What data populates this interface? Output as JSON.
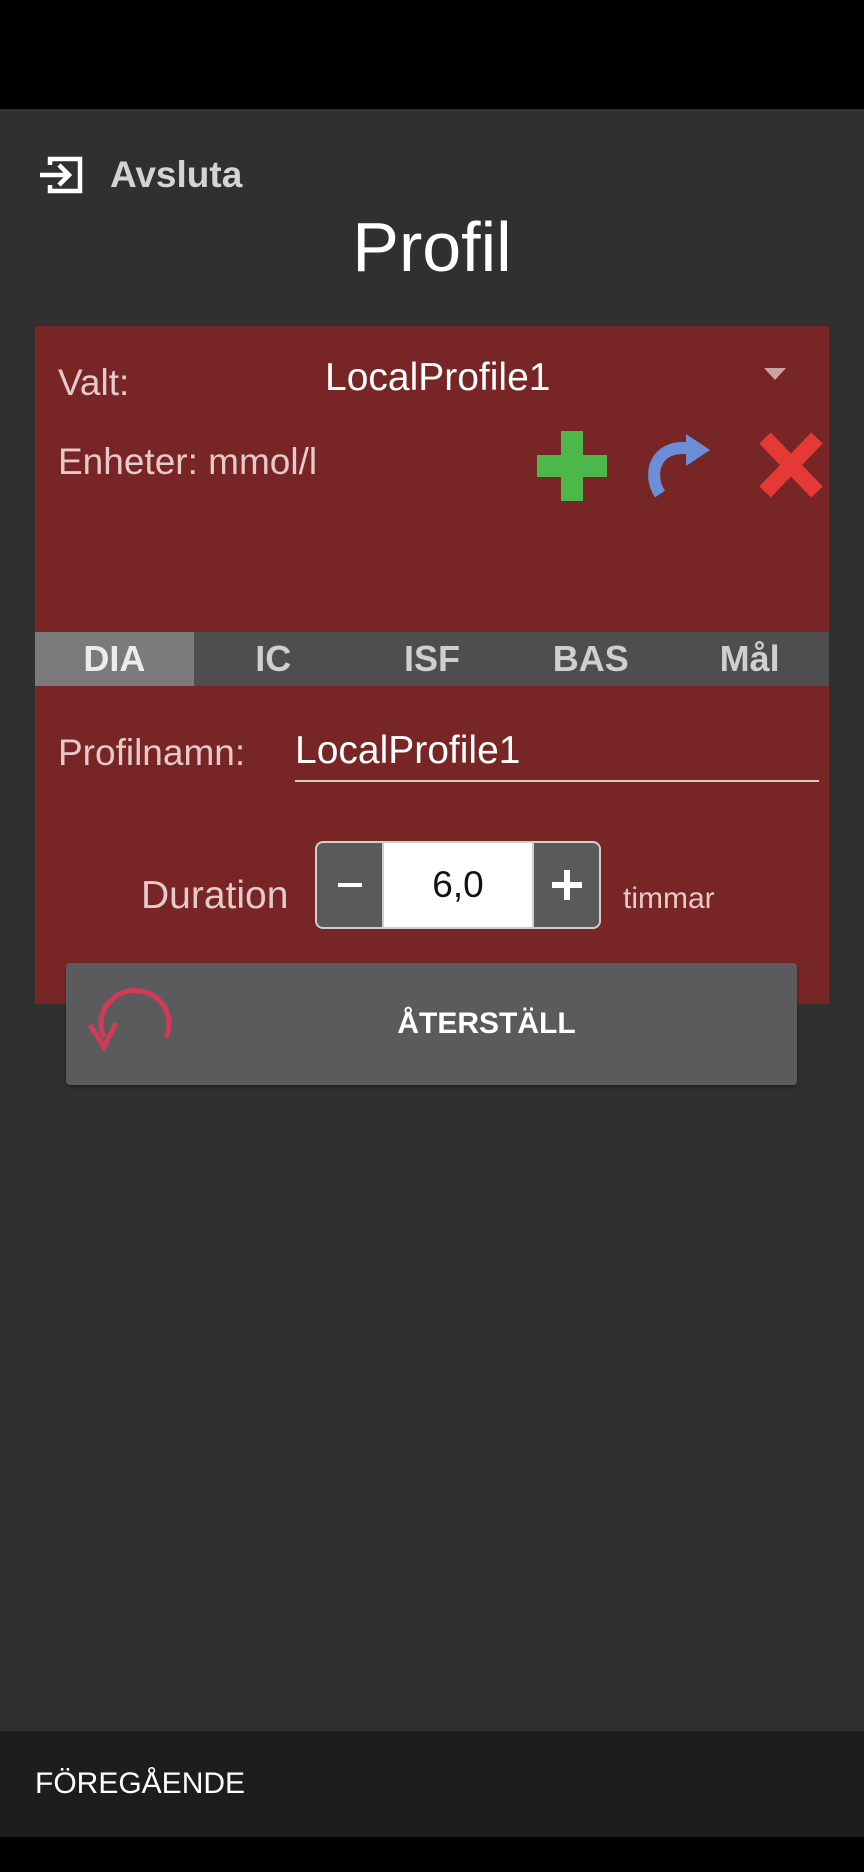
{
  "header": {
    "exit_label": "Avsluta",
    "title": "Profil"
  },
  "profile": {
    "selected_label": "Valt:",
    "selected_value": "LocalProfile1",
    "units_label": "Enheter: mmol/l"
  },
  "icons": {
    "exit": "exit-icon",
    "add": "plus-icon",
    "clone": "redo-arrow-icon",
    "delete": "close-x-icon",
    "reset": "undo-circle-icon"
  },
  "colors": {
    "card_bg": "#772525",
    "screen_bg": "#303030",
    "add": "#4cb84a",
    "clone": "#6a8fd8",
    "delete": "#e53935",
    "reset_icon": "#d23a58"
  },
  "tabs": [
    {
      "label": "DIA",
      "active": true
    },
    {
      "label": "IC",
      "active": false
    },
    {
      "label": "ISF",
      "active": false
    },
    {
      "label": "BAS",
      "active": false
    },
    {
      "label": "Mål",
      "active": false
    }
  ],
  "form": {
    "name_label": "Profilnamn:",
    "name_value": "LocalProfile1",
    "duration_label": "Duration",
    "duration_value": "6,0",
    "duration_unit": "timmar",
    "minus": "−",
    "plus": "+",
    "reset_label": "ÅTERSTÄLL"
  },
  "footer": {
    "prev_label": "FÖREGÅENDE"
  }
}
